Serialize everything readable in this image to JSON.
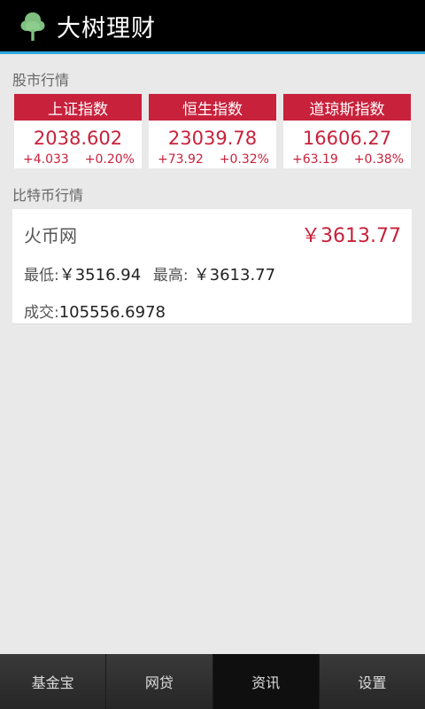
{
  "app": {
    "title": "大树理财",
    "icon": "tree-icon",
    "accent_color": "#2aa7e0",
    "brand_red": "#c8213b"
  },
  "stock_section": {
    "label": "股市行情",
    "indices": [
      {
        "name": "上证指数",
        "value": "2038.602",
        "change": "+4.033",
        "change_pct": "+0.20%"
      },
      {
        "name": "恒生指数",
        "value": "23039.78",
        "change": "+73.92",
        "change_pct": "+0.32%"
      },
      {
        "name": "道琼斯指数",
        "value": "16606.27",
        "change": "+63.19",
        "change_pct": "+0.38%"
      }
    ]
  },
  "btc_section": {
    "label": "比特币行情",
    "exchange": "火币网",
    "price": "￥3613.77",
    "low_label": "最低:",
    "low_value": "￥3516.94",
    "high_label": "最高:",
    "high_value": "￥3613.77",
    "volume_label": "成交:",
    "volume_value": "105556.6978"
  },
  "tabs": [
    {
      "label": "基金宝",
      "active": false
    },
    {
      "label": "网贷",
      "active": false
    },
    {
      "label": "资讯",
      "active": true
    },
    {
      "label": "设置",
      "active": false
    }
  ]
}
